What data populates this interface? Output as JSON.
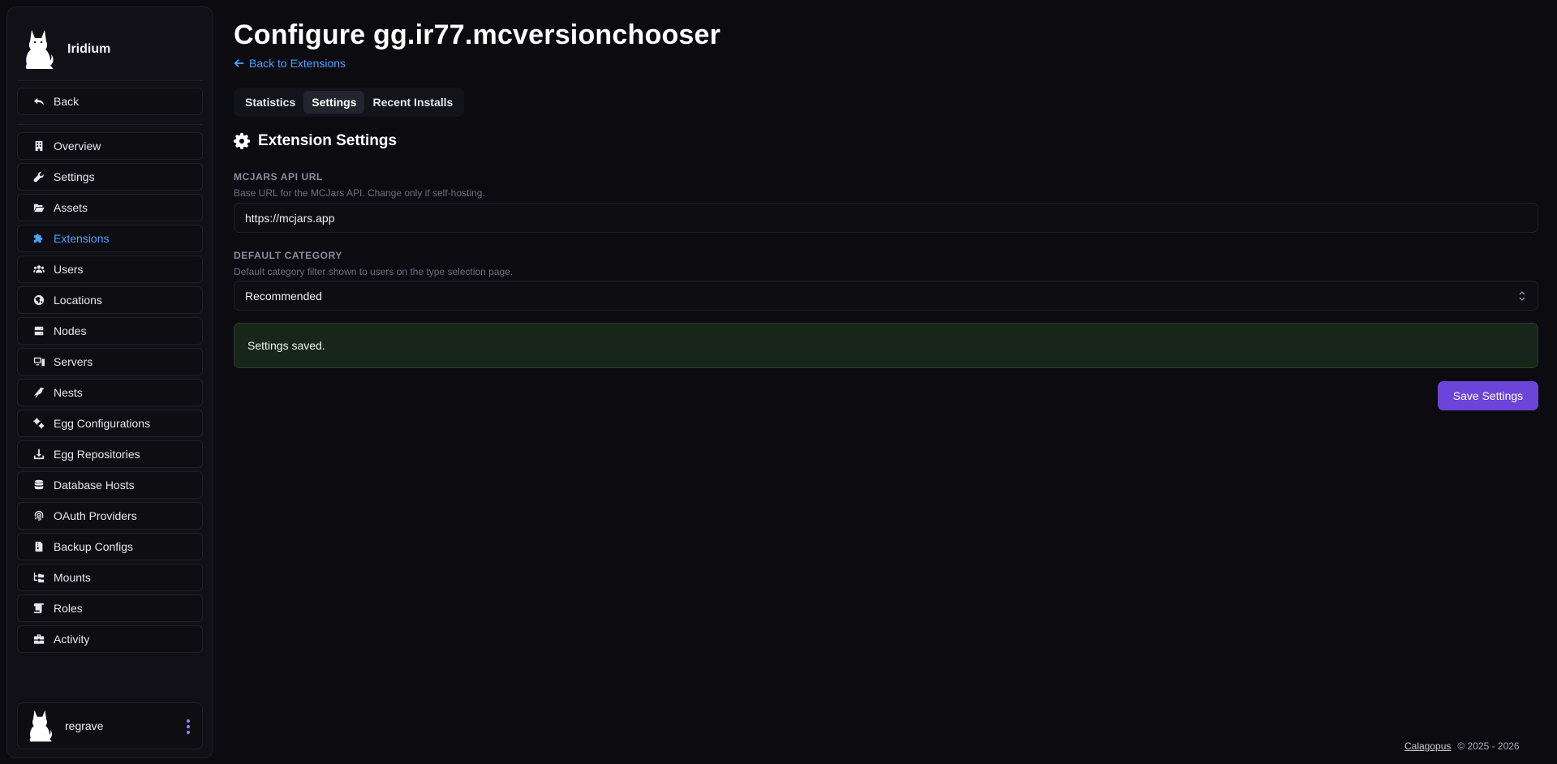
{
  "sidebar": {
    "brand_name": "Iridium",
    "back_label": "Back",
    "items": [
      {
        "label": "Overview",
        "icon": "building-icon"
      },
      {
        "label": "Settings",
        "icon": "wrench-icon"
      },
      {
        "label": "Assets",
        "icon": "folder-open-icon"
      },
      {
        "label": "Extensions",
        "icon": "puzzle-icon",
        "active": true
      },
      {
        "label": "Users",
        "icon": "users-icon"
      },
      {
        "label": "Locations",
        "icon": "globe-icon"
      },
      {
        "label": "Nodes",
        "icon": "server-icon"
      },
      {
        "label": "Servers",
        "icon": "computer-icon"
      },
      {
        "label": "Nests",
        "icon": "crow-icon"
      },
      {
        "label": "Egg Configurations",
        "icon": "gears-icon"
      },
      {
        "label": "Egg Repositories",
        "icon": "download-icon"
      },
      {
        "label": "Database Hosts",
        "icon": "database-icon"
      },
      {
        "label": "OAuth Providers",
        "icon": "fingerprint-icon"
      },
      {
        "label": "Backup Configs",
        "icon": "file-zipper-icon"
      },
      {
        "label": "Mounts",
        "icon": "folder-tree-icon"
      },
      {
        "label": "Roles",
        "icon": "scroll-icon"
      },
      {
        "label": "Activity",
        "icon": "briefcase-icon"
      }
    ],
    "user": {
      "name": "regrave"
    }
  },
  "header": {
    "title": "Configure gg.ir77.mcversionchooser",
    "back_link": "Back to Extensions"
  },
  "tabs": [
    {
      "label": "Statistics",
      "active": false
    },
    {
      "label": "Settings",
      "active": true
    },
    {
      "label": "Recent Installs",
      "active": false
    }
  ],
  "settings": {
    "section_title": "Extension Settings",
    "api_url": {
      "label": "MCJARS API URL",
      "description": "Base URL for the MCJars API. Change only if self-hosting.",
      "value": "https://mcjars.app"
    },
    "default_category": {
      "label": "DEFAULT CATEGORY",
      "description": "Default category filter shown to users on the type selection page.",
      "value": "Recommended"
    },
    "alert": "Settings saved.",
    "save_label": "Save Settings"
  },
  "footer": {
    "brand": "Calagopus",
    "copyright": "© 2025 - 2026"
  },
  "colors": {
    "accent": "#4ea1ff",
    "primary_button": "#6c44d9",
    "success_bg": "#172619"
  }
}
